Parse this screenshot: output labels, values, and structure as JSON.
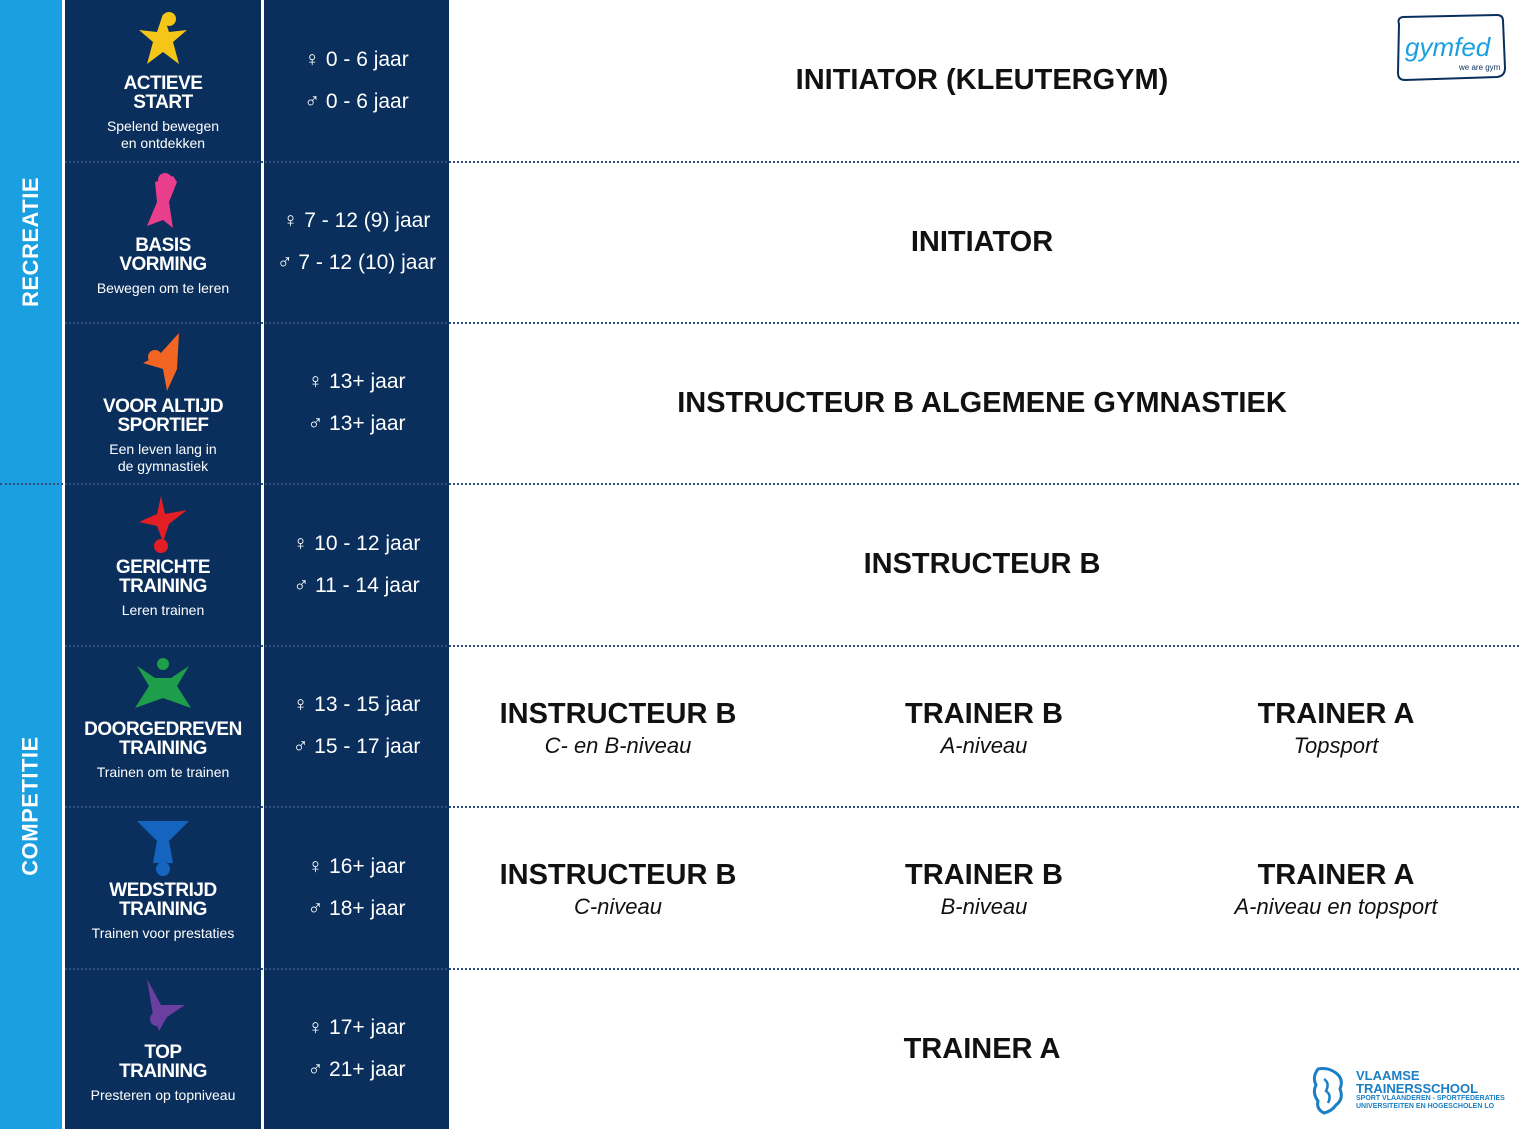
{
  "sidebar": {
    "top_label": "RECREATIE",
    "bottom_label": "COMPETITIE"
  },
  "colors": {
    "navy": "#0a2f5c",
    "sky": "#1a9fe0"
  },
  "logo": {
    "brand": "gymfed",
    "tagline": "we are gym"
  },
  "footer_logo": {
    "line1": "VLAAMSE",
    "line2": "TRAINERSSCHOOL",
    "line3": "SPORT VLAANDEREN - SPORTFEDERATIES",
    "line4": "UNIVERSITEITEN EN HOGESCHOLEN LO"
  },
  "rows": [
    {
      "icon": "yellow-star-figure-icon",
      "color": "#f5c518",
      "title1": "ACTIEVE",
      "title2": "START",
      "sub1": "Spelend bewegen",
      "sub2": "en ontdekken",
      "age_f": "♀ 0 - 6 jaar",
      "age_m": "♂ 0 - 6 jaar",
      "main": "INITIATOR (KLEUTERGYM)"
    },
    {
      "icon": "pink-figure-icon",
      "color": "#e83e8c",
      "title1": "BASIS",
      "title2": "VORMING",
      "sub1": "Bewegen om te leren",
      "sub2": "",
      "age_f": "♀ 7 - 12 (9) jaar",
      "age_m": "♂ 7 - 12 (10) jaar",
      "main": "INITIATOR"
    },
    {
      "icon": "orange-figure-icon",
      "color": "#f26522",
      "title1": "VOOR ALTIJD",
      "title2": "SPORTIEF",
      "sub1": "Een leven lang in",
      "sub2": "de gymnastiek",
      "age_f": "♀ 13+ jaar",
      "age_m": "♂ 13+ jaar",
      "main": "INSTRUCTEUR B ALGEMENE GYMNASTIEK"
    },
    {
      "icon": "red-figure-icon",
      "color": "#e31e24",
      "title1": "GERICHTE",
      "title2": "TRAINING",
      "sub1": "Leren trainen",
      "sub2": "",
      "age_f": "♀ 10 - 12 jaar",
      "age_m": "♂ 11 - 14 jaar",
      "main": "INSTRUCTEUR B"
    },
    {
      "icon": "green-figure-icon",
      "color": "#1e9e4a",
      "title1": "DOORGEDREVEN",
      "title2": "TRAINING",
      "sub1": "Trainen om te trainen",
      "sub2": "",
      "age_f": "♀ 13 - 15 jaar",
      "age_m": "♂ 15 - 17 jaar",
      "cols": [
        {
          "t": "INSTRUCTEUR B",
          "s": "C- en B-niveau"
        },
        {
          "t": "TRAINER B",
          "s": "A-niveau"
        },
        {
          "t": "TRAINER A",
          "s": "Topsport"
        }
      ]
    },
    {
      "icon": "blue-figure-icon",
      "color": "#1565c0",
      "title1": "WEDSTRIJD",
      "title2": "TRAINING",
      "sub1": "Trainen voor prestaties",
      "sub2": "",
      "age_f": "♀ 16+ jaar",
      "age_m": "♂ 18+ jaar",
      "cols": [
        {
          "t": "INSTRUCTEUR B",
          "s": "C-niveau"
        },
        {
          "t": "TRAINER B",
          "s": "B-niveau"
        },
        {
          "t": "TRAINER A",
          "s": "A-niveau en topsport"
        }
      ]
    },
    {
      "icon": "purple-figure-icon",
      "color": "#6a3fa0",
      "title1": "TOP",
      "title2": "TRAINING",
      "sub1": "Presteren op topniveau",
      "sub2": "",
      "age_f": "♀ 17+ jaar",
      "age_m": "♂ 21+ jaar",
      "main": "TRAINER A"
    }
  ]
}
